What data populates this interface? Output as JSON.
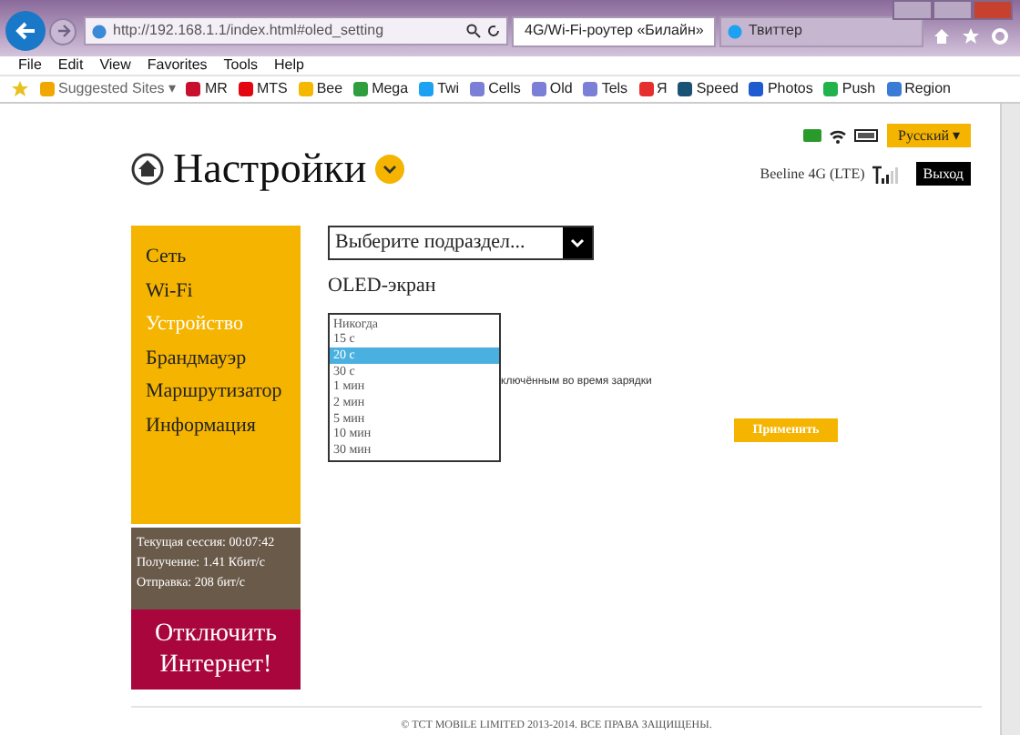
{
  "browser": {
    "address": "http://192.168.1.1/index.html#oled_setting",
    "tabs": [
      {
        "label": "4G/Wi-Fi-роутер «Билайн»",
        "selected": true
      },
      {
        "label": "Твиттер",
        "selected": false
      }
    ],
    "menu": [
      "File",
      "Edit",
      "View",
      "Favorites",
      "Tools",
      "Help"
    ],
    "favorites": [
      {
        "label": "Suggested Sites ▾",
        "color": "#f0a800"
      },
      {
        "label": "MR",
        "color": "#c8102e"
      },
      {
        "label": "MTS",
        "color": "#e30611"
      },
      {
        "label": "Bee",
        "color": "#f5b800"
      },
      {
        "label": "Mega",
        "color": "#2e9e3e"
      },
      {
        "label": "Twi",
        "color": "#1da1f2"
      },
      {
        "label": "Cells",
        "color": "#7b7fd6"
      },
      {
        "label": "Old",
        "color": "#7b7fd6"
      },
      {
        "label": "Tels",
        "color": "#7b7fd6"
      },
      {
        "label": "Я",
        "color": "#e62e2e"
      },
      {
        "label": "Speed",
        "color": "#1a5276"
      },
      {
        "label": "Photos",
        "color": "#1e5bd0"
      },
      {
        "label": "Push",
        "color": "#21b24b"
      },
      {
        "label": "Region",
        "color": "#3a7bd5"
      }
    ]
  },
  "header": {
    "title": "Настройки",
    "language": "Русский ▾",
    "network": "Beeline 4G (LTE)",
    "logout": "Выход"
  },
  "sidebar": {
    "items": [
      {
        "label": "Сеть",
        "selected": false
      },
      {
        "label": "Wi-Fi",
        "selected": false
      },
      {
        "label": "Устройство",
        "selected": true
      },
      {
        "label": "Брандмауэр",
        "selected": false
      },
      {
        "label": "Маршрутизатор",
        "selected": false
      },
      {
        "label": "Информация",
        "selected": false
      }
    ],
    "stats": [
      "Текущая сессия: 00:07:42",
      "Получение: 1.41 Кбит/с",
      "Отправка: 208 бит/с"
    ],
    "disconnect": "Отключить Интернет!"
  },
  "content": {
    "section_select": "Выберите подраздел...",
    "heading": "OLED-экран",
    "options": [
      {
        "label": "Никогда",
        "selected": false
      },
      {
        "label": "15 с",
        "selected": false
      },
      {
        "label": "20 с",
        "selected": true
      },
      {
        "label": "30 с",
        "selected": false
      },
      {
        "label": "1 мин",
        "selected": false
      },
      {
        "label": "2 мин",
        "selected": false
      },
      {
        "label": "5 мин",
        "selected": false
      },
      {
        "label": "10 мин",
        "selected": false
      },
      {
        "label": "30 мин",
        "selected": false
      }
    ],
    "partial_note": "ключённым во время зарядки",
    "apply": "Применить"
  },
  "footer": "© TCT MOBILE LIMITED 2013-2014. ВСЕ ПРАВА ЗАЩИЩЕНЫ."
}
